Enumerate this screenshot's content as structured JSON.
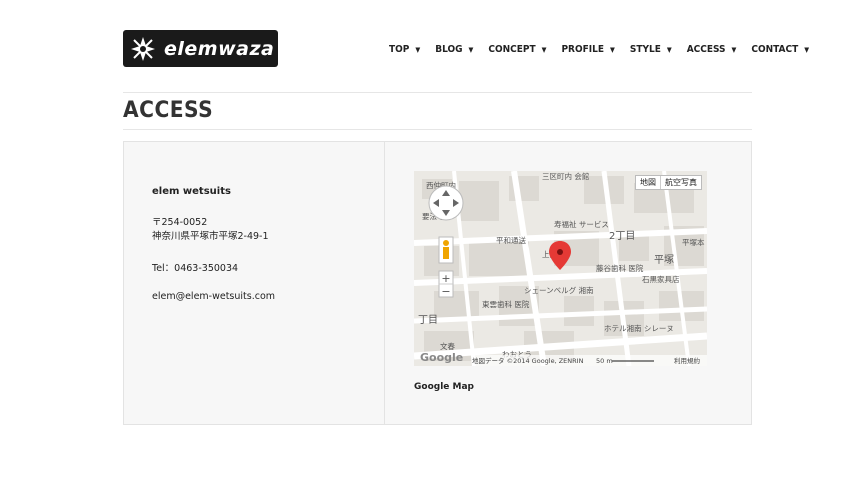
{
  "brand": {
    "name": "elemwaza"
  },
  "nav": [
    {
      "label": "TOP"
    },
    {
      "label": "BLOG"
    },
    {
      "label": "CONCEPT"
    },
    {
      "label": "PROFILE"
    },
    {
      "label": "STYLE"
    },
    {
      "label": "ACCESS"
    },
    {
      "label": "CONTACT"
    }
  ],
  "page_title": "ACCESS",
  "contact": {
    "company": "elem wetsuits",
    "postal": "〒254-0052",
    "address": "神奈川県平塚市平塚2-49-1",
    "tel": "Tel：0463-350034",
    "email": "elem@elem-wetsuits.com"
  },
  "map": {
    "caption": "Google Map",
    "type_map": "地図",
    "type_satellite": "航空写真",
    "attribution": "地図データ ©2014 Google, ZENRIN",
    "scale": "50 m",
    "terms": "利用規約",
    "google_logo": "Google",
    "labels": [
      {
        "text": "西仲町内"
      },
      {
        "text": "三区町内\n会館"
      },
      {
        "text": "要法寺"
      },
      {
        "text": "寿福祉\nサービス"
      },
      {
        "text": "2丁目"
      },
      {
        "text": "平和通送"
      },
      {
        "text": "上田..店"
      },
      {
        "text": "平塚"
      },
      {
        "text": "平塚本\n郵便局"
      },
      {
        "text": "藤谷歯科\n医院"
      },
      {
        "text": "石黒家具店"
      },
      {
        "text": "シェーンベルグ\n湘南"
      },
      {
        "text": "東雲歯科\n医院"
      },
      {
        "text": "丁目"
      },
      {
        "text": "ホテル湘南\nシレーヌ"
      },
      {
        "text": "文春"
      },
      {
        "text": "わおとう"
      }
    ]
  },
  "colors": {
    "accent": "#222222",
    "pin": "#e53935",
    "panel": "#f7f7f7"
  }
}
